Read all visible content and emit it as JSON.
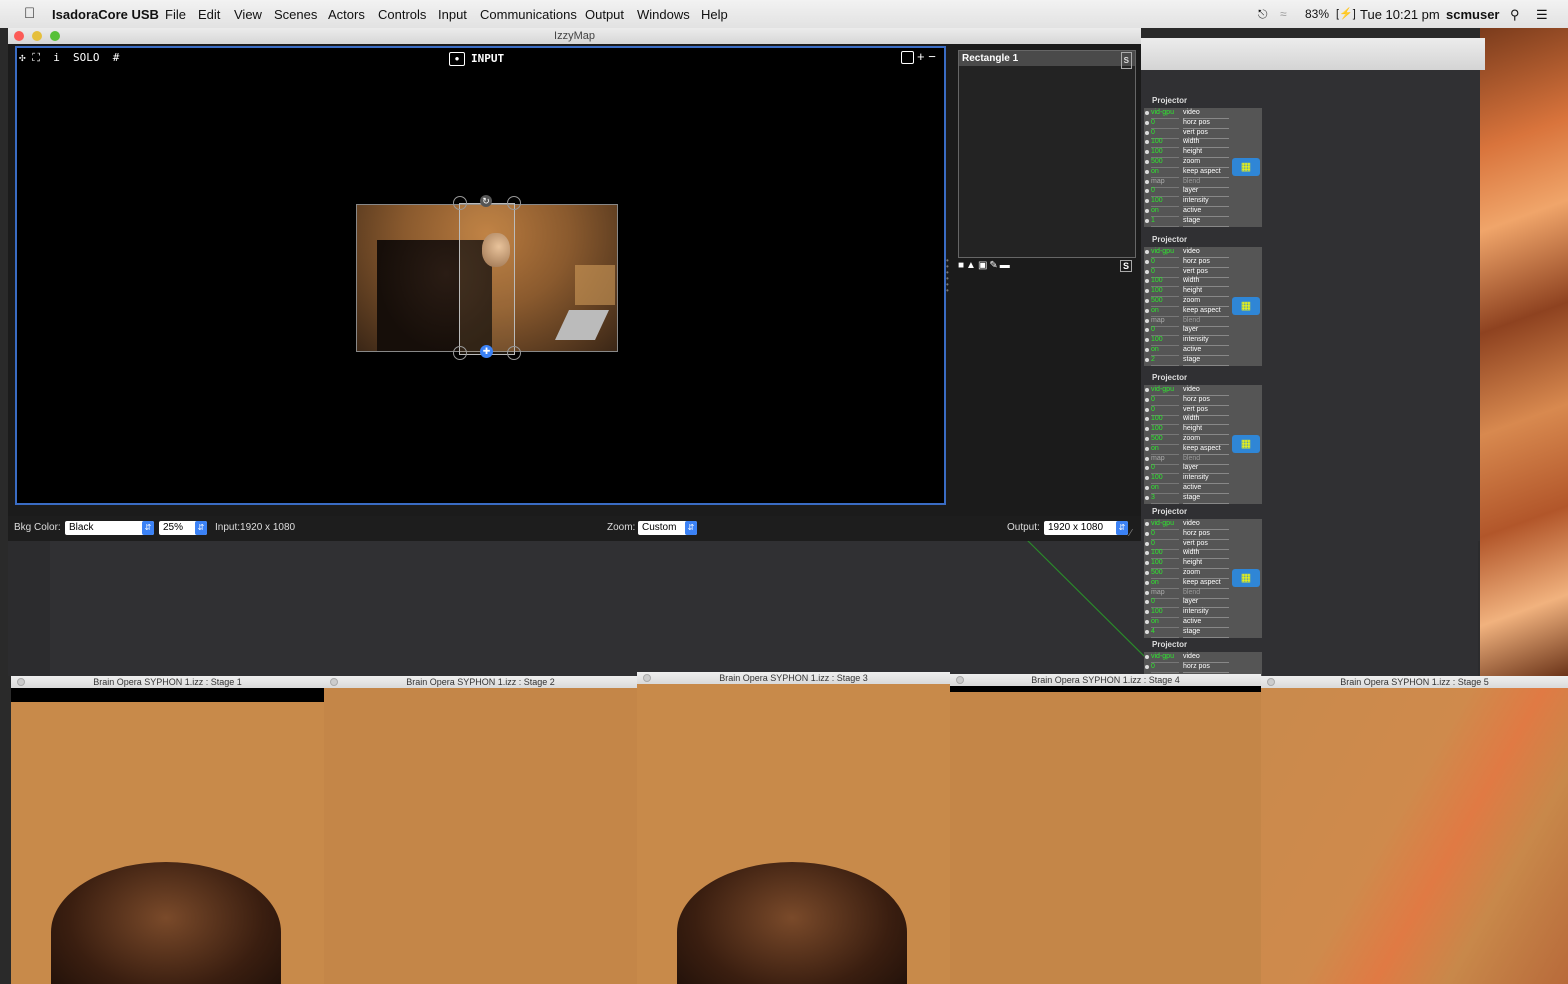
{
  "menubar": {
    "apple": "",
    "app_name": "IsadoraCore USB",
    "items": [
      "File",
      "Edit",
      "View",
      "Scenes",
      "Actors",
      "Controls",
      "Input",
      "Communications",
      "Output",
      "Windows",
      "Help"
    ],
    "battery": "83%",
    "clock": "Tue 10:21 pm",
    "user": "scmuser"
  },
  "izzymap": {
    "title": "IzzyMap",
    "toolbar_left": "✣ ⛶  i  SOLO  #",
    "mode_label": "INPUT",
    "toolbar_right": "+ −",
    "panel_title": "Rectangle 1",
    "panel_s": "S",
    "bottom": {
      "bkg_label": "Bkg Color:",
      "bkg_value": "Black",
      "zoom_pct": "25%",
      "input_info": "Input:1920 x 1080",
      "zoom_label": "Zoom:",
      "zoom_value": "Custom",
      "output_label": "Output:",
      "output_value": "1920 x 1080"
    }
  },
  "actors": [
    {
      "title": "Projector",
      "rows": [
        [
          "vid-gpu",
          "video"
        ],
        [
          "0",
          "horz pos"
        ],
        [
          "0",
          "vert pos"
        ],
        [
          "100",
          "width"
        ],
        [
          "100",
          "height"
        ],
        [
          "500",
          "zoom"
        ],
        [
          "on",
          "keep aspect"
        ],
        [
          "map",
          "blend"
        ],
        [
          "0",
          "layer"
        ],
        [
          "100",
          "intensity"
        ],
        [
          "on",
          "active"
        ],
        [
          "1",
          "stage"
        ]
      ]
    },
    {
      "title": "Projector",
      "rows": [
        [
          "vid-gpu",
          "video"
        ],
        [
          "0",
          "horz pos"
        ],
        [
          "0",
          "vert pos"
        ],
        [
          "100",
          "width"
        ],
        [
          "100",
          "height"
        ],
        [
          "500",
          "zoom"
        ],
        [
          "on",
          "keep aspect"
        ],
        [
          "map",
          "blend"
        ],
        [
          "0",
          "layer"
        ],
        [
          "100",
          "intensity"
        ],
        [
          "on",
          "active"
        ],
        [
          "2",
          "stage"
        ]
      ]
    },
    {
      "title": "Projector",
      "rows": [
        [
          "vid-gpu",
          "video"
        ],
        [
          "0",
          "horz pos"
        ],
        [
          "0",
          "vert pos"
        ],
        [
          "100",
          "width"
        ],
        [
          "100",
          "height"
        ],
        [
          "500",
          "zoom"
        ],
        [
          "on",
          "keep aspect"
        ],
        [
          "map",
          "blend"
        ],
        [
          "0",
          "layer"
        ],
        [
          "100",
          "intensity"
        ],
        [
          "on",
          "active"
        ],
        [
          "3",
          "stage"
        ]
      ]
    },
    {
      "title": "Projector",
      "rows": [
        [
          "vid-gpu",
          "video"
        ],
        [
          "0",
          "horz pos"
        ],
        [
          "0",
          "vert pos"
        ],
        [
          "100",
          "width"
        ],
        [
          "100",
          "height"
        ],
        [
          "500",
          "zoom"
        ],
        [
          "on",
          "keep aspect"
        ],
        [
          "map",
          "blend"
        ],
        [
          "0",
          "layer"
        ],
        [
          "100",
          "intensity"
        ],
        [
          "on",
          "active"
        ],
        [
          "4",
          "stage"
        ]
      ]
    },
    {
      "title": "Projector",
      "rows": [
        [
          "vid-gpu",
          "video"
        ],
        [
          "0",
          "horz pos"
        ]
      ]
    }
  ],
  "stages": [
    "Brain Opera SYPHON 1.izz : Stage 1",
    "Brain Opera SYPHON 1.izz : Stage 2",
    "Brain Opera SYPHON 1.izz : Stage 3",
    "Brain Opera SYPHON 1.izz : Stage 4",
    "Brain Opera SYPHON 1.izz : Stage 5"
  ]
}
